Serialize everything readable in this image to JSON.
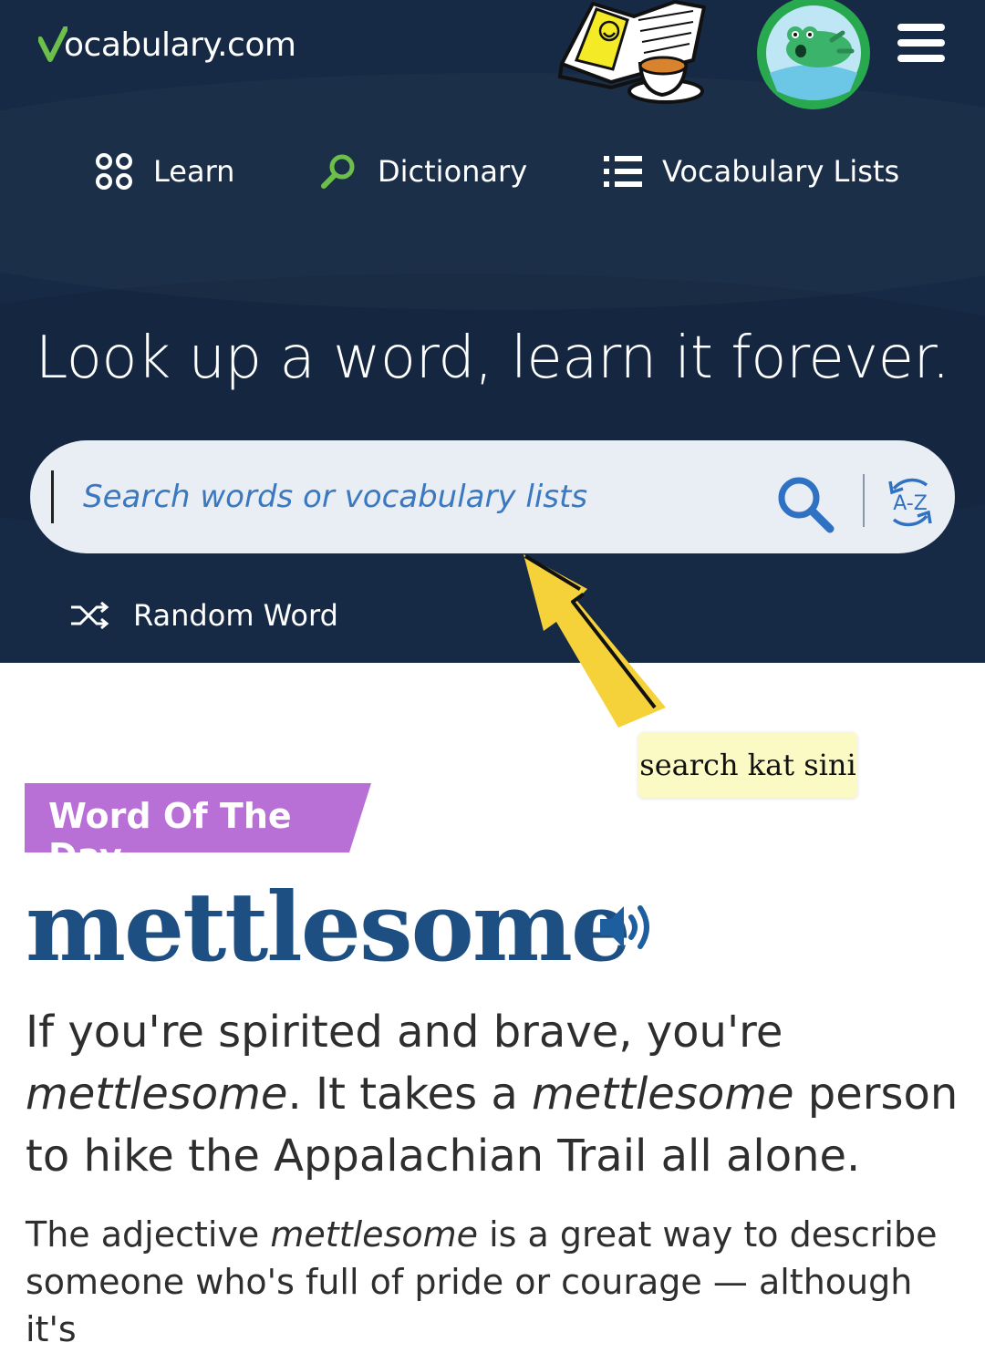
{
  "brand": {
    "logo_text": "ocabulary.com",
    "logo_initial": "V"
  },
  "header": {
    "menu_icon": "hamburger-menu-icon",
    "avatar_icon": "frog-avatar-icon",
    "sticker_icon": "reading-book-coffee-sticker"
  },
  "nav": [
    {
      "label": "Learn",
      "icon": "learn-grid-icon"
    },
    {
      "label": "Dictionary",
      "icon": "magnifier-icon"
    },
    {
      "label": "Vocabulary Lists",
      "icon": "list-icon"
    }
  ],
  "hero": {
    "tagline": "Look up a word, learn it forever."
  },
  "search": {
    "placeholder": "Search words or vocabulary lists",
    "value": "",
    "search_icon": "search-icon",
    "az_icon": "a-z-icon",
    "random_label": "Random Word",
    "random_icon": "shuffle-icon"
  },
  "annotation": {
    "note": "search kat sini",
    "color": "#f6d23a"
  },
  "word_of_the_day": {
    "badge": "Word Of The Day",
    "word": "mettlesome",
    "blurb": {
      "part1": "If you're spirited and brave, you're ",
      "em1": "mettlesome",
      "part2": ". It takes a ",
      "em2": "mettlesome",
      "part3": " person to hike the Appalachian Trail all alone."
    },
    "longdef": {
      "part1": "The adjective ",
      "em1": "mettlesome",
      "part2": " is a great way to describe someone who's full of pride or courage — although it's"
    }
  },
  "colors": {
    "hero_bg": "#172a45",
    "accent_green": "#6cc04a",
    "badge_purple": "#b86fd6",
    "word_blue": "#1d4f82",
    "link_blue": "#2f72c4"
  }
}
